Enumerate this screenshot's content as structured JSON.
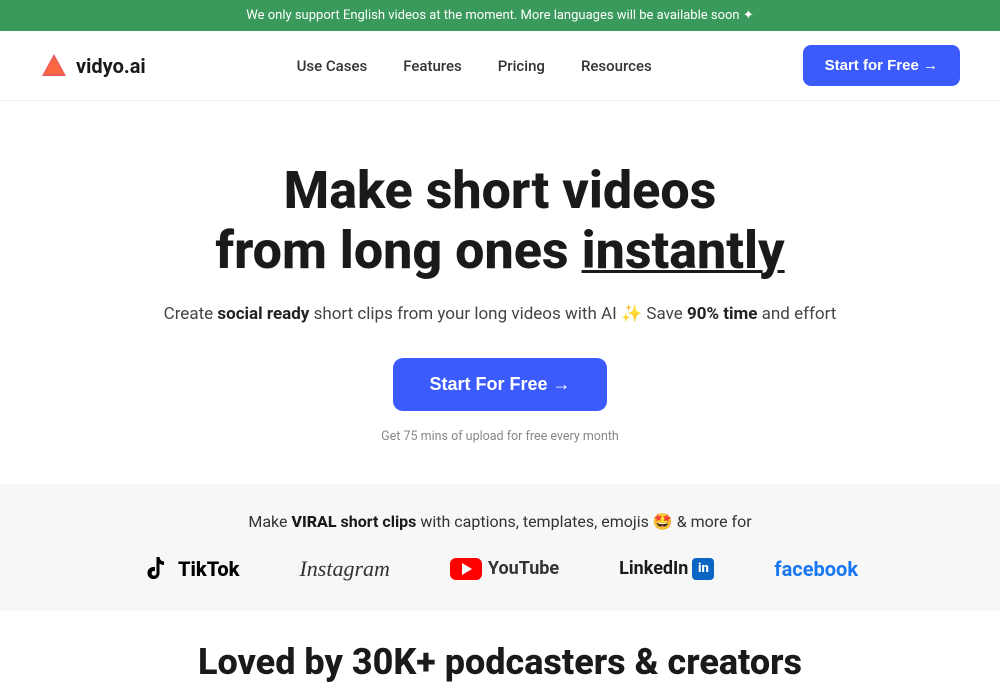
{
  "banner": {
    "text": "We only support English videos at the moment. More languages will be available soon ✦"
  },
  "nav": {
    "logo_text": "vidyo.ai",
    "links": [
      {
        "label": "Use Cases",
        "id": "use-cases"
      },
      {
        "label": "Features",
        "id": "features"
      },
      {
        "label": "Pricing",
        "id": "pricing"
      },
      {
        "label": "Resources",
        "id": "resources"
      }
    ],
    "cta_label": "Start for Free →"
  },
  "hero": {
    "headline_line1": "Make short videos",
    "headline_line2": "from long ones ",
    "headline_underline": "instantly",
    "subtext_before": "Create ",
    "subtext_bold1": "social ready",
    "subtext_middle": " short clips from your long videos with AI ✨ Save ",
    "subtext_bold2": "90% time",
    "subtext_end": " and effort",
    "cta_label": "Start For Free →",
    "note": "Get 75 mins of upload for free every month"
  },
  "social_bar": {
    "text_prefix": "Make ",
    "viral": "VIRAL",
    "clips": " short clips",
    "text_suffix": " with captions, templates, emojis 🤩 & more for",
    "platforms": [
      {
        "name": "TikTok",
        "type": "tiktok"
      },
      {
        "name": "Instagram",
        "type": "instagram"
      },
      {
        "name": "YouTube",
        "type": "youtube"
      },
      {
        "name": "LinkedIn",
        "type": "linkedin"
      },
      {
        "name": "facebook",
        "type": "facebook"
      }
    ]
  },
  "loved_section": {
    "headline": "Loved by 30K+ podcasters & creators"
  }
}
